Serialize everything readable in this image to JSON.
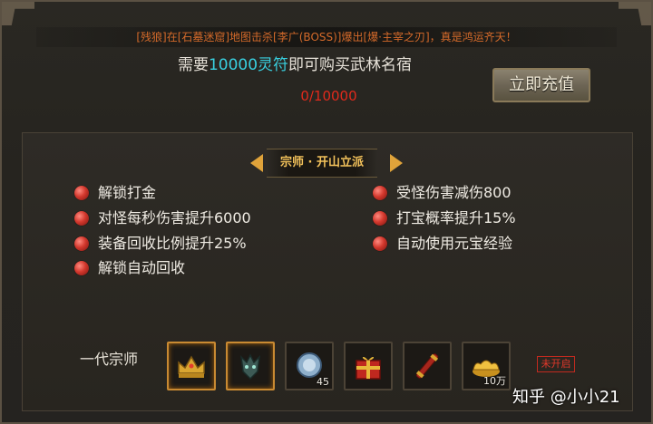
{
  "ticker": "[残狼]在[石墓迷窟]地图击杀[李广(BOSS)]爆出[爆·主宰之刃]，真是鸿运齐天！",
  "requirement": {
    "prefix": "需要",
    "amount": "10000灵符",
    "suffix": "即可购买武林名宿",
    "progress": "0/10000"
  },
  "recharge_button": "立即充值",
  "panel_title": "宗师 · 开山立派",
  "benefits_left": [
    "解锁打金",
    "对怪每秒伤害提升6000",
    "装备回收比例提升25%",
    "解锁自动回收"
  ],
  "benefits_right": [
    "受怪伤害减伤800",
    "打宝概率提升15%",
    "自动使用元宝经验"
  ],
  "rank_label": "一代宗师",
  "reward_slots": [
    {
      "icon": "crown-icon",
      "count": ""
    },
    {
      "icon": "dragon-mask-icon",
      "count": ""
    },
    {
      "icon": "gem-icon",
      "count": "45"
    },
    {
      "icon": "gift-box-icon",
      "count": ""
    },
    {
      "icon": "scroll-icon",
      "count": ""
    },
    {
      "icon": "gold-ingot-icon",
      "count": "10万"
    }
  ],
  "status_badge": "未开启",
  "watermark": "知乎 @小小21",
  "colors": {
    "ticker_text": "#d46a2a",
    "amount_highlight": "#39d0e0",
    "progress_text": "#e02a1c",
    "title_gold": "#f3c25b",
    "locked_red": "#e3382a"
  }
}
